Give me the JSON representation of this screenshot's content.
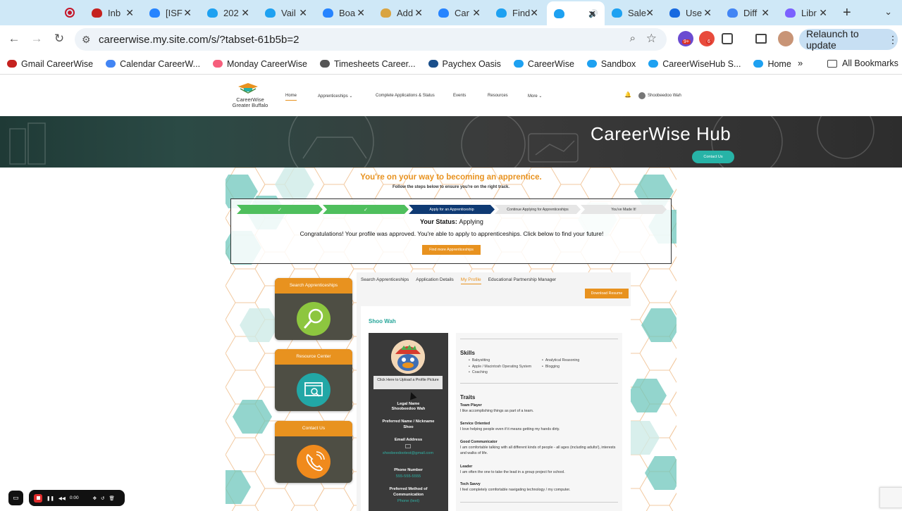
{
  "browser": {
    "tabs": [
      {
        "label": "Inb",
        "color": "#c5221f"
      },
      {
        "label": "[ISF",
        "color": "#2684ff"
      },
      {
        "label": "202",
        "color": "#1ea1f1"
      },
      {
        "label": "Vail",
        "color": "#1ea1f1"
      },
      {
        "label": "Boa",
        "color": "#2684ff"
      },
      {
        "label": "Add",
        "color": "#d9a441"
      },
      {
        "label": "Car",
        "color": "#2684ff"
      },
      {
        "label": "Find",
        "color": "#1ea1f1"
      },
      {
        "label": "",
        "color": "#1ea1f1"
      },
      {
        "label": "Sale",
        "color": "#1ea1f1"
      },
      {
        "label": "Use",
        "color": "#1769e0"
      },
      {
        "label": "Diff",
        "color": "#4285f4"
      },
      {
        "label": "Libr",
        "color": "#7b61ff"
      }
    ],
    "active_tab_index": 8,
    "url": "careerwise.my.site.com/s/?tabset-61b5b=2",
    "relaunch_label": "Relaunch to update",
    "ext_badges": [
      "9+",
      "6"
    ],
    "bookmarks": [
      {
        "label": "Gmail CareerWise",
        "color": "#c5221f"
      },
      {
        "label": "Calendar CareerW...",
        "color": "#4285f4"
      },
      {
        "label": "Monday CareerWise",
        "color": "#f65f7c"
      },
      {
        "label": "Timesheets Career...",
        "color": "#555555"
      },
      {
        "label": "Paychex Oasis",
        "color": "#1a4e8a"
      },
      {
        "label": "CareerWise",
        "color": "#1ea1f1"
      },
      {
        "label": "Sandbox",
        "color": "#1ea1f1"
      },
      {
        "label": "CareerWiseHub S...",
        "color": "#1ea1f1"
      },
      {
        "label": "Home",
        "color": "#1ea1f1"
      }
    ],
    "all_bookmarks": "All Bookmarks"
  },
  "site": {
    "logo_line1": "CareerWise",
    "logo_line2": "Greater Buffalo",
    "nav": {
      "home": "Home",
      "apprenticeships": "Apprenticeships",
      "complete": "Complete Applications & Status",
      "events": "Events",
      "resources": "Resources",
      "more": "More",
      "user": "Shoobeedoo Wah"
    },
    "hero_title": "CareerWise Hub",
    "contact_button": "Contact Us",
    "headline": "You're on your way to becoming an apprentice.",
    "subheadline": "Follow the steps below to ensure you're on the right track.",
    "steps": [
      "✓",
      "✓",
      "Apply for an Apprenticeship",
      "Continue Applying for Apprenticeships",
      "You've Made It!"
    ],
    "status_label": "Your Status:",
    "status_value": "Applying",
    "status_message": "Congratulations! Your profile was approved. You're able to apply to apprenticeships. Click below to find your future!",
    "find_button": "Find more Apprenticeships",
    "cards": [
      "Search Apprenticeships",
      "Resource Center",
      "Contact Us"
    ],
    "profile_tabs": [
      "Search Apprenticeships",
      "Application Details",
      "My Profile",
      "Educational Partnership Manager"
    ],
    "download_button": "Download Resume",
    "profile_name": "Shoo Wah",
    "upload_label": "Click Here to Upload a Profile Picture",
    "legal_name_label": "Legal Name",
    "legal_name": "Shoobeedoo Wah",
    "nickname_label": "Preferred Name / Nickname",
    "nickname": "Shoo",
    "email_label": "Email Address",
    "email": "shoobeedootest@gmail.com",
    "phone_label": "Phone Number",
    "phone": "555-555-5555",
    "contact_method_label": "Preferred Method of Communication",
    "contact_method": "Phone (text)",
    "skills_heading": "Skills",
    "skills_left": [
      "Babysitting",
      "Apple / Macintosh Operating System",
      "Coaching"
    ],
    "skills_right": [
      "Analytical Reasoning",
      "Blogging"
    ],
    "traits_heading": "Traits",
    "traits": [
      {
        "name": "Team Player",
        "desc": "I like accomplishing things as part of a team."
      },
      {
        "name": "Service Oriented",
        "desc": "I love helping people even if it means getting my hands dirty."
      },
      {
        "name": "Good Communicator",
        "desc": "I am comfortable talking with all different kinds of people - all ages (including adults!), interests and walks of life."
      },
      {
        "name": "Leader",
        "desc": "I am often the one to take the lead in a group project for school."
      },
      {
        "name": "Tech Savvy",
        "desc": "I feel completely comfortable navigating technology / my computer."
      }
    ]
  },
  "recorder": {
    "time": "0:00"
  }
}
